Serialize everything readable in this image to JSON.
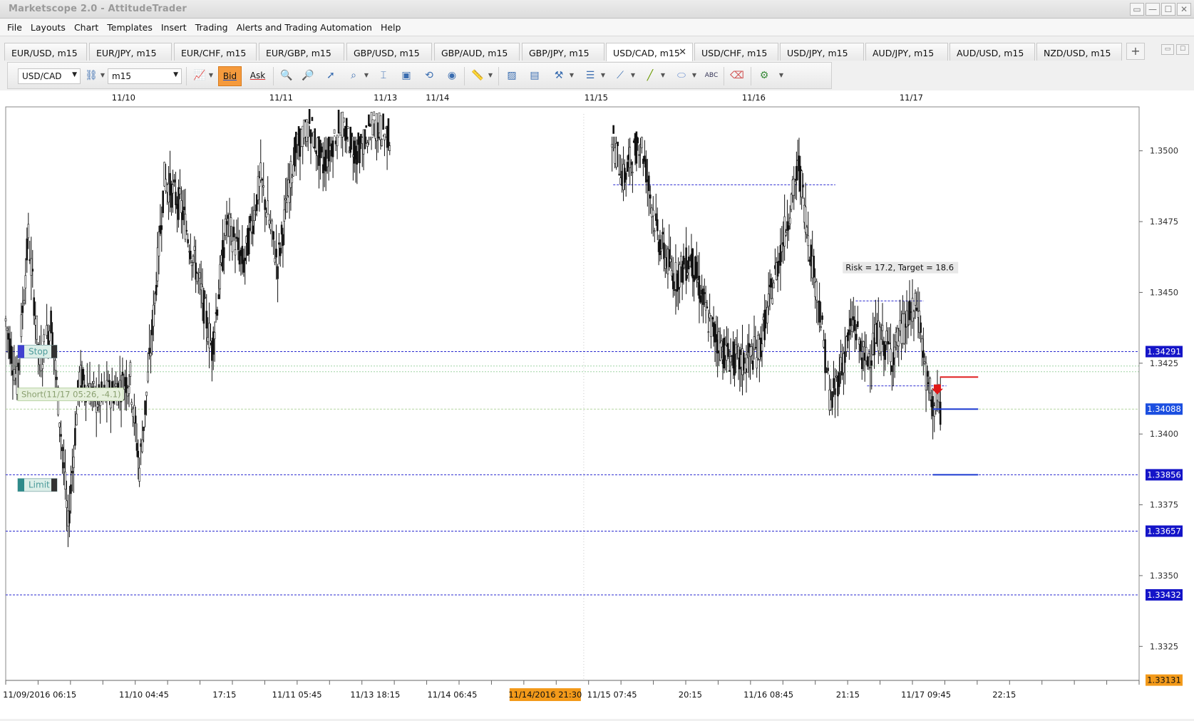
{
  "window": {
    "title": "Marketscope 2.0 - AttitudeTrader",
    "buttons": [
      "▭",
      "—",
      "☐",
      "✕"
    ]
  },
  "menu": [
    "File",
    "Layouts",
    "Chart",
    "Templates",
    "Insert",
    "Trading",
    "Alerts and Trading Automation",
    "Help"
  ],
  "tabs": [
    {
      "label": "EUR/USD, m15",
      "active": false
    },
    {
      "label": "EUR/JPY, m15",
      "active": false
    },
    {
      "label": "EUR/CHF, m15",
      "active": false
    },
    {
      "label": "EUR/GBP, m15",
      "active": false
    },
    {
      "label": "GBP/USD, m15",
      "active": false
    },
    {
      "label": "GBP/AUD, m15",
      "active": false
    },
    {
      "label": "GBP/JPY, m15",
      "active": false
    },
    {
      "label": "USD/CAD, m15",
      "active": true
    },
    {
      "label": "USD/CHF, m15",
      "active": false
    },
    {
      "label": "USD/JPY, m15",
      "active": false
    },
    {
      "label": "AUD/JPY, m15",
      "active": false
    },
    {
      "label": "AUD/USD, m15",
      "active": false
    },
    {
      "label": "NZD/USD, m15",
      "active": false
    }
  ],
  "tab_close": "✕",
  "tab_add": "+",
  "toolbar": {
    "instrument": "USD/CAD",
    "timeframe": "m15",
    "bid_label": "Bid",
    "ask_label": "Ask",
    "dropdown_arrow": "▼"
  },
  "chart_data": {
    "type": "candlestick",
    "instrument": "USD/CAD",
    "timeframe": "m15",
    "ylim": [
      1.3313,
      1.3513
    ],
    "y_ticks": [
      "1.3500",
      "1.3475",
      "1.3450",
      "1.3425",
      "1.3400",
      "1.3375",
      "1.3350",
      "1.3325"
    ],
    "top_date_labels": [
      "11/10",
      "11/11",
      "11/13",
      "11/14",
      "11/15",
      "11/16",
      "11/17"
    ],
    "bottom_time_labels": [
      "11/09/2016 06:15",
      "11/10 04:45",
      "17:15",
      "11/11 05:45",
      "11/13 18:15",
      "11/14 06:45",
      "11/15 07:45",
      "20:15",
      "11/16 08:45",
      "21:15",
      "11/17 09:45",
      "22:15"
    ],
    "cursor_time_label": "11/14/2016 21:30",
    "price_lines": [
      {
        "price": 1.34291,
        "label": "1.34291",
        "kind": "stop"
      },
      {
        "price": 1.34088,
        "label": "1.34088",
        "kind": "current"
      },
      {
        "price": 1.33856,
        "label": "1.33856",
        "kind": "limit"
      },
      {
        "price": 1.33657,
        "label": "1.33657",
        "kind": "level"
      },
      {
        "price": 1.33432,
        "label": "1.33432",
        "kind": "level"
      },
      {
        "price": 1.33131,
        "label": "1.33131",
        "kind": "bottom"
      }
    ],
    "annotations": {
      "stop_label": "Stop",
      "limit_label": "Limit",
      "short_label": "Short(11/17 05:26, -4.1)",
      "risk_target": "Risk = 17.2, Target = 18.6"
    },
    "price_path": [
      [
        0.0,
        1.344
      ],
      [
        0.01,
        1.3418
      ],
      [
        0.02,
        1.347
      ],
      [
        0.03,
        1.3425
      ],
      [
        0.04,
        1.344
      ],
      [
        0.05,
        1.3395
      ],
      [
        0.055,
        1.3367
      ],
      [
        0.065,
        1.342
      ],
      [
        0.08,
        1.3412
      ],
      [
        0.095,
        1.3415
      ],
      [
        0.11,
        1.342
      ],
      [
        0.118,
        1.3388
      ],
      [
        0.128,
        1.343
      ],
      [
        0.14,
        1.349
      ],
      [
        0.155,
        1.348
      ],
      [
        0.17,
        1.3455
      ],
      [
        0.182,
        1.343
      ],
      [
        0.195,
        1.3475
      ],
      [
        0.21,
        1.346
      ],
      [
        0.225,
        1.349
      ],
      [
        0.24,
        1.346
      ],
      [
        0.255,
        1.35
      ],
      [
        0.268,
        1.351
      ],
      [
        0.28,
        1.3495
      ],
      [
        0.295,
        1.351
      ],
      [
        0.31,
        1.35
      ],
      [
        0.325,
        1.351
      ],
      [
        0.34,
        1.3505
      ],
      [
        0.535,
        1.3505
      ],
      [
        0.545,
        1.349
      ],
      [
        0.56,
        1.3505
      ],
      [
        0.575,
        1.347
      ],
      [
        0.59,
        1.3455
      ],
      [
        0.605,
        1.3462
      ],
      [
        0.62,
        1.344
      ],
      [
        0.635,
        1.3428
      ],
      [
        0.65,
        1.3425
      ],
      [
        0.665,
        1.343
      ],
      [
        0.68,
        1.3458
      ],
      [
        0.692,
        1.348
      ],
      [
        0.7,
        1.3495
      ],
      [
        0.708,
        1.347
      ],
      [
        0.718,
        1.3445
      ],
      [
        0.728,
        1.341
      ],
      [
        0.738,
        1.3425
      ],
      [
        0.748,
        1.344
      ],
      [
        0.758,
        1.3425
      ],
      [
        0.77,
        1.3435
      ],
      [
        0.782,
        1.3428
      ],
      [
        0.795,
        1.344
      ],
      [
        0.805,
        1.3445
      ],
      [
        0.812,
        1.342
      ],
      [
        0.818,
        1.341
      ],
      [
        0.822,
        1.3412
      ],
      [
        0.826,
        1.3407
      ]
    ],
    "trade_box": {
      "x_start": 0.818,
      "x_end": 0.858,
      "stop_price": 1.34201,
      "entry_price": 1.34088,
      "target_price": 1.33856
    },
    "range_lines": [
      {
        "x_start": 0.536,
        "x_end": 0.732,
        "price": 1.3488
      },
      {
        "x_start": 0.75,
        "x_end": 0.81,
        "price": 1.3447
      },
      {
        "x_start": 0.76,
        "x_end": 0.83,
        "price": 1.3417
      }
    ],
    "session_divider_x": 0.51,
    "highlight_price_band": [
      1.3424,
      1.3422
    ]
  }
}
